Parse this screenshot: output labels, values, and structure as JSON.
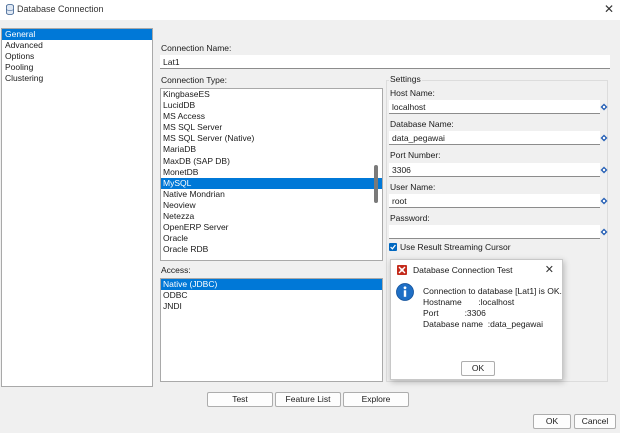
{
  "window": {
    "title": "Database Connection",
    "close_glyph": "✕"
  },
  "nav": {
    "items": [
      "General",
      "Advanced",
      "Options",
      "Pooling",
      "Clustering"
    ],
    "selected": 0
  },
  "connection_name": {
    "label": "Connection Name:",
    "value": "Lat1"
  },
  "connection_type": {
    "label": "Connection Type:",
    "items": [
      "KingbaseES",
      "LucidDB",
      "MS Access",
      "MS SQL Server",
      "MS SQL Server (Native)",
      "MariaDB",
      "MaxDB (SAP DB)",
      "MonetDB",
      "MySQL",
      "Native Mondrian",
      "Neoview",
      "Netezza",
      "OpenERP Server",
      "Oracle",
      "Oracle RDB"
    ],
    "selected": 8
  },
  "access": {
    "label": "Access:",
    "items": [
      "Native (JDBC)",
      "ODBC",
      "JNDI"
    ],
    "selected": 0
  },
  "settings": {
    "group_label": "Settings",
    "host_label": "Host Name:",
    "host_value": "localhost",
    "db_label": "Database Name:",
    "db_value": "data_pegawai",
    "port_label": "Port Number:",
    "port_value": "3306",
    "user_label": "User Name:",
    "user_value": "root",
    "password_label": "Password:",
    "password_value": "",
    "streaming_label": "Use Result Streaming Cursor",
    "streaming_checked": true
  },
  "buttons": {
    "test": "Test",
    "feature_list": "Feature List",
    "explore": "Explore",
    "ok": "OK",
    "cancel": "Cancel"
  },
  "popup": {
    "title": "Database Connection Test",
    "close_glyph": "✕",
    "message": "Connection to database [Lat1] is OK.",
    "host_line": "Hostname       :localhost",
    "port_line": "Port           :3306",
    "dbname_line": "Database name  :data_pegawai",
    "ok": "OK"
  },
  "colors": {
    "selection": "#0078d7",
    "checkbox": "#0067c0",
    "info_icon": "#1f6fc5",
    "spin_icon": "#2e66b8",
    "popup_icon": "#c42b1c"
  }
}
